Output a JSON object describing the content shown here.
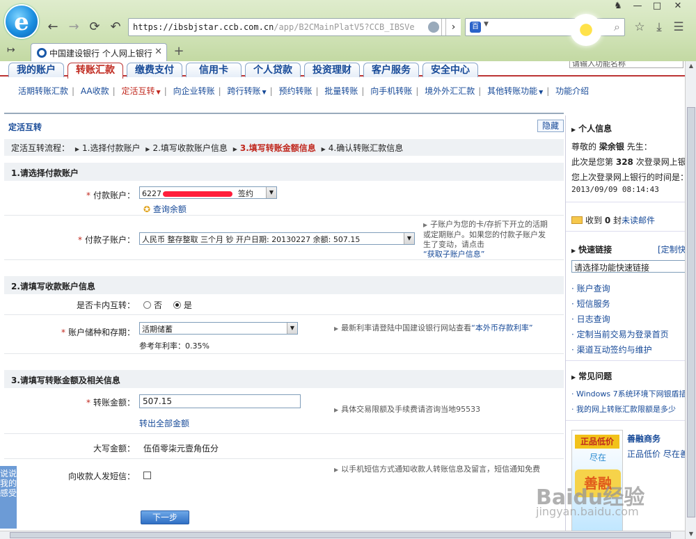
{
  "browser": {
    "url_main": "https://ibsbjstar.ccb.com.cn",
    "url_dim": "/app/B2CMainPlatV5?CCB_IBSVe",
    "tab_title": "中国建设银行 个人网上银行"
  },
  "menu": {
    "tabs": [
      "我的账户",
      "转账汇款",
      "缴费支付",
      "信用卡",
      "个人贷款",
      "投资理财",
      "客户服务",
      "安全中心"
    ],
    "func_search": "请输入功能名称"
  },
  "submenu": [
    "活期转账汇款",
    "AA收款",
    "定活互转",
    "向企业转账",
    "跨行转账",
    "预约转账",
    "批量转账",
    "向手机转账",
    "境外外汇汇款",
    "其他转账功能",
    "功能介绍"
  ],
  "main": {
    "title": "定活互转",
    "hide": "隐藏",
    "flow_label": "定活互转流程：",
    "steps": [
      "1.选择付款账户",
      "2.填写收款账户信息",
      "3.填写转账金额信息",
      "4.确认转账汇款信息"
    ],
    "sec1": "1.请选择付款账户",
    "pay_account_label": "付款账户：",
    "pay_account_prefix": "6227",
    "pay_account_suffix": "签约",
    "query_balance": "查询余额",
    "sub_account_label": "付款子账户：",
    "sub_account_value": "人民币 整存整取 三个月   钞 开户日期: 20130227  余额: 507.15",
    "sub_hint": "子账户为您的卡/存折下开立的活期或定期账户。如果您的付款子账户发生了变动，请点击",
    "sub_hint_link": "“获取子账户信息”",
    "sec2": "2.请填写收款账户信息",
    "inner_label": "是否卡内互转：",
    "opt_no": "否",
    "opt_yes": "是",
    "deposit_label": "账户储种和存期：",
    "deposit_value": "活期储蓄",
    "rate_text": "参考年利率：0.35%",
    "rate_hint": "最新利率请登陆中国建设银行网站查看",
    "rate_hint_link": "“本外币存款利率”",
    "sec3": "3.请填写转账金额及相关信息",
    "amount_label": "转账金额：",
    "amount_value": "507.15",
    "transfer_all": "转出全部金额",
    "amount_hint": "具体交易限额及手续费请咨询当地95533",
    "upper_label": "大写金额：",
    "upper_value": "伍佰零柒元壹角伍分",
    "sms_label": "向收款人发短信：",
    "sms_hint": "以手机短信方式通知收款人转账信息及留言，短信通知免费",
    "next": "下一步",
    "feedback": "说说我的感受"
  },
  "sidebar": {
    "personal_title": "个人信息",
    "greeting_pre": "尊敬的",
    "name": "梁余银",
    "greeting_post": "先生：",
    "login_pre": "此次是您第",
    "login_count": "328",
    "login_post": "次登录网上银",
    "last_login": "您上次登录网上银行的时间是：",
    "last_time": "2013/09/09 08:14:43",
    "mail_pre": "收到",
    "mail_count": "0",
    "mail_mid": "封",
    "mail_link": "未读邮件",
    "quick_title": "快速链接",
    "quick_custom": "[定制快",
    "quick_select": "请选择功能快速链接",
    "quick_links": [
      "账户查询",
      "短信服务",
      "日志查询",
      "定制当前交易为登录首页",
      "渠道互动签约与维护"
    ],
    "faq_title": "常见问题",
    "faq_links": [
      "Windows 7系统环境下网银盾插",
      "我的网上转账汇款限额是多少"
    ],
    "ad_brand": "善融商务",
    "ad_text": "正品低价 尽在善",
    "ad_badge": "正品低价",
    "ad_sub": "尽在",
    "ad_big": "善融"
  },
  "watermark": "Baidu经验",
  "watermark2": "jingyan.baidu.com"
}
